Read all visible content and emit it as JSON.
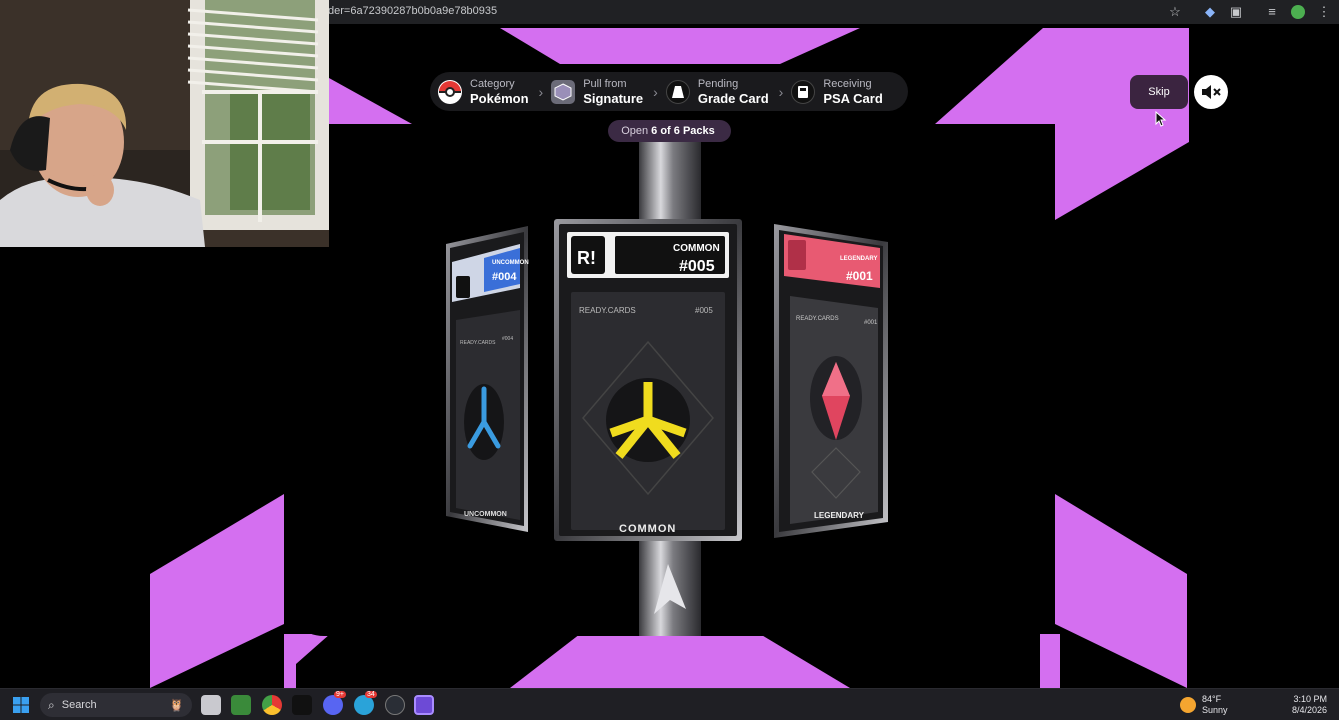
{
  "browser": {
    "url_text": "der=6a72390287b0b0a9e78b0935"
  },
  "steps": [
    {
      "label": "Category",
      "value": "Pokémon"
    },
    {
      "label": "Pull from",
      "value": "Signature"
    },
    {
      "label": "Pending",
      "value": "Grade Card"
    },
    {
      "label": "Receiving",
      "value": "PSA Card"
    }
  ],
  "packs": {
    "prefix": "Open",
    "count": "6 of 6 Packs"
  },
  "skip_label": "Skip",
  "cards": {
    "left": {
      "grade": "UNCOMMON",
      "number": "#004",
      "brand": "READY.CARDS",
      "rarity": "UNCOMMON",
      "color": "#3a9be0"
    },
    "center": {
      "grade": "COMMON",
      "number": "#005",
      "brand": "READY.CARDS",
      "rarity": "COMMON",
      "color": "#f0dc1e"
    },
    "right": {
      "grade": "LEGENDARY",
      "number": "#001",
      "brand": "READY.CARDS",
      "rarity": "LEGENDARY",
      "color": "#e0455f"
    }
  },
  "logo_text": "R!",
  "taskbar": {
    "search_placeholder": "Search",
    "weather_temp": "84°F",
    "weather_desc": "Sunny",
    "time": "3:10 PM",
    "date": "8/4/2026",
    "badges": [
      "9+",
      "34"
    ]
  },
  "colors": {
    "accent": "#d46ff0",
    "pill": "#3b2a44",
    "skip": "#3b2440"
  }
}
